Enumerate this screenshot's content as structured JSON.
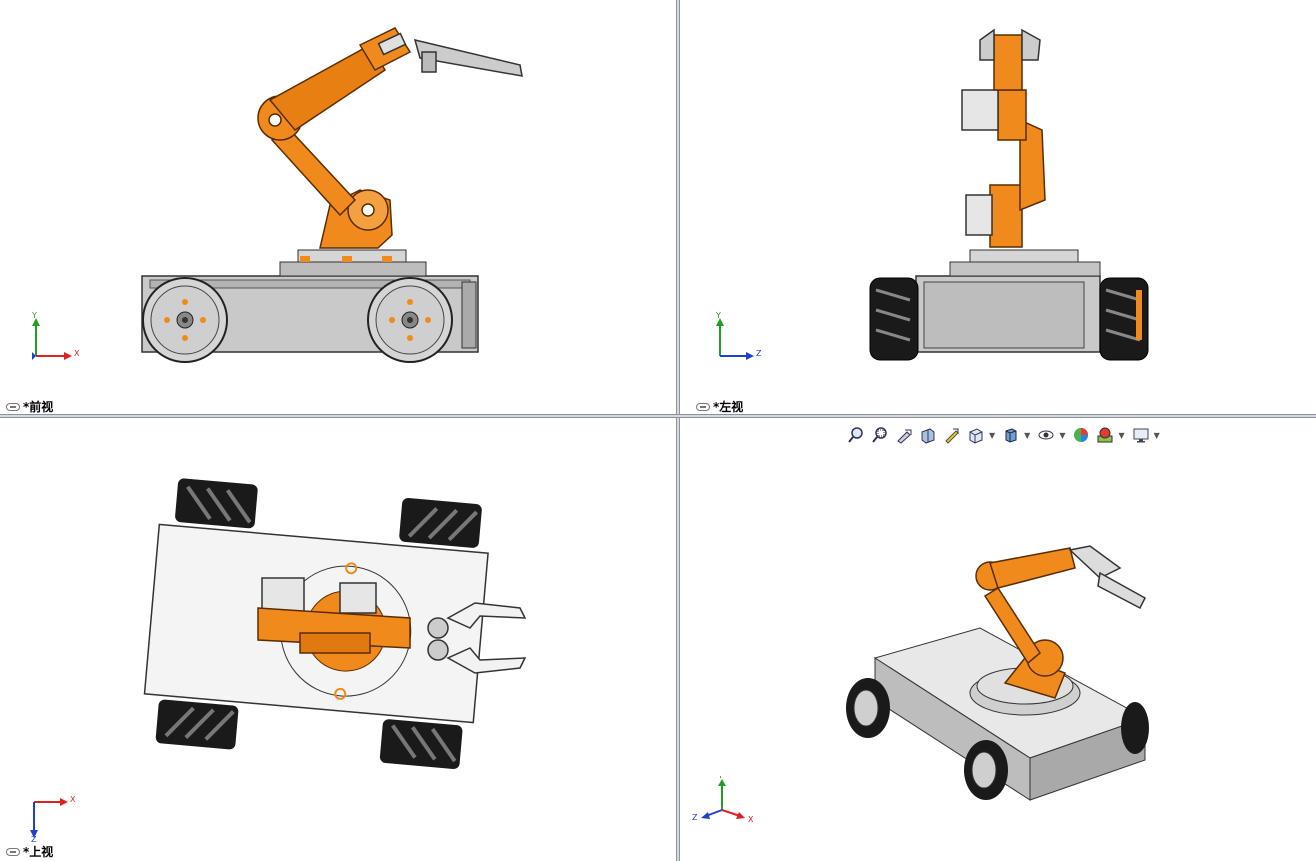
{
  "viewports": {
    "front": {
      "label": "*前视",
      "triad": {
        "axis1": "Y",
        "axis2": "X"
      }
    },
    "left": {
      "label": "*左视",
      "triad": {
        "axis1": "Y",
        "axis2": "Z"
      }
    },
    "top": {
      "label": "*上视",
      "triad": {
        "axis1": "X",
        "axis2": "Z"
      }
    },
    "iso": {
      "triad": {
        "axis1": "Y",
        "axis2": "Z",
        "axis3": "X"
      }
    }
  },
  "toolbar": {
    "icons": [
      "zoom-to-fit-icon",
      "zoom-to-area-icon",
      "previous-view-icon",
      "section-view-icon",
      "dynamic-annotation-icon",
      "view-orientation-icon",
      "display-style-icon",
      "hide-show-items-icon",
      "edit-appearance-icon",
      "apply-scene-icon",
      "view-settings-icon"
    ]
  },
  "colors": {
    "orange": "#f08a1c",
    "orange_dark": "#b35a05",
    "gray_body": "#c8c8c8",
    "wheel_dark": "#1a1a1a",
    "axis_x": "#e02020",
    "axis_y": "#20a020",
    "axis_z": "#2040d0"
  }
}
